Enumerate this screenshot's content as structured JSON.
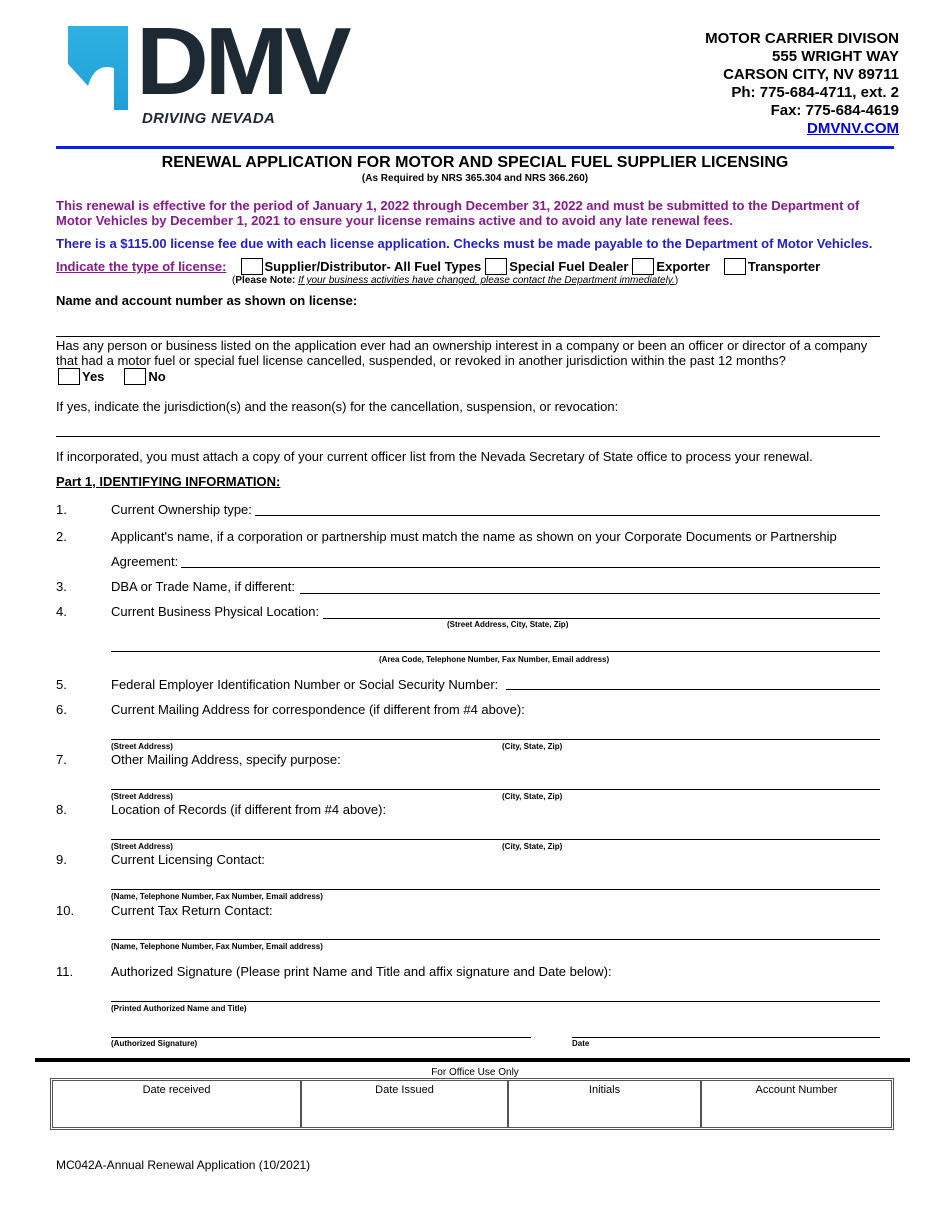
{
  "header": {
    "logo": {
      "wordmark": "DMV",
      "tagline": "DRIVING NEVADA",
      "colors": {
        "mark_blue": "#29a8dc",
        "wordmark": "#1e2a33"
      }
    },
    "address": {
      "lines": [
        "MOTOR CARRIER DIVISON",
        "555 WRIGHT WAY",
        "CARSON CITY, NV  89711",
        "Ph: 775-684-4711, ext. 2",
        "Fax: 775-684-4619"
      ],
      "website": "DMVNV.COM"
    },
    "rule_color": "#0a1fe6"
  },
  "form": {
    "title": "RENEWAL APPLICATION FOR MOTOR AND SPECIAL FUEL SUPPLIER LICENSING",
    "subtitle": "(As Required by NRS 365.304 and NRS 366.260)",
    "notice_period": "This renewal is effective for the period of January 1, 2022 through December 31, 2022 and must be submitted to the Department of Motor Vehicles by December 1, 2021 to ensure your license remains active and to avoid any late renewal fees.",
    "notice_fee": "There is a $115.00 license fee due with each license application. Checks must be made payable to the Department of Motor Vehicles.",
    "colors": {
      "purple": "#8a1a8c",
      "blue": "#1f1fd1"
    },
    "license_type": {
      "label": "Indicate the type of license:",
      "options": [
        "Supplier/Distributor- All Fuel Types",
        "Special Fuel Dealer",
        "Exporter",
        "Transporter"
      ],
      "note_prefix": "Please Note:",
      "note_text": "If your business activities have changed, please contact the Department immediately."
    },
    "name_account_label": "Name and account number as shown on license:",
    "ownership_question": "Has any person or business listed on the application ever had an ownership interest in a company or been an officer or director of a company that had a motor fuel or special fuel license cancelled, suspended, or revoked in another jurisdiction within the past 12 months?",
    "yes_label": "Yes",
    "no_label": "No",
    "if_yes": "If yes, indicate the jurisdiction(s) and the reason(s) for the cancellation, suspension, or revocation:",
    "incorporated_note": "If incorporated, you must attach a copy of your current officer list from the Nevada Secretary of State office to process your renewal.",
    "part1_heading": "Part 1, IDENTIFYING INFORMATION:",
    "items": [
      {
        "num": "1.",
        "label": "Current Ownership type:"
      },
      {
        "num": "2.",
        "label": "Applicant's name, if a corporation or partnership must match the name as shown on your Corporate Documents or Partnership",
        "label2": "Agreement:"
      },
      {
        "num": "3.",
        "label": "DBA or Trade Name, if different:"
      },
      {
        "num": "4.",
        "label": "Current Business Physical Location:",
        "caption1": "(Street Address, City, State, Zip)",
        "caption2": "(Area Code, Telephone Number, Fax Number, Email address)"
      },
      {
        "num": "5.",
        "label": "Federal Employer Identification Number or Social Security Number:"
      },
      {
        "num": "6.",
        "label": "Current Mailing Address for correspondence (if different from #4 above):",
        "caption1": "(Street Address)",
        "caption2": "(City, State, Zip)"
      },
      {
        "num": "7.",
        "label": "Other Mailing Address, specify purpose:",
        "caption1": "(Street Address)",
        "caption2": "(City, State, Zip)"
      },
      {
        "num": "8.",
        "label": "Location of Records (if different from #4 above):",
        "caption1": "(Street Address)",
        "caption2": "(City, State, Zip)"
      },
      {
        "num": "9.",
        "label": "Current Licensing Contact:",
        "caption1": "(Name, Telephone Number, Fax Number, Email address)"
      },
      {
        "num": "10.",
        "label": "Current Tax Return Contact:",
        "caption1": "(Name, Telephone Number, Fax Number, Email address)"
      },
      {
        "num": "11.",
        "label": "Authorized Signature (Please print Name and Title and affix signature and Date below):",
        "caption1": "(Printed Authorized Name and Title)",
        "caption2": "(Authorized Signature)",
        "caption3": "Date"
      }
    ]
  },
  "office_use": {
    "label": "For Office Use Only",
    "columns": [
      "Date received",
      "Date Issued",
      "Initials",
      "Account Number"
    ]
  },
  "footer": {
    "form_id": "MC042A-Annual Renewal Application (10/2021)"
  }
}
